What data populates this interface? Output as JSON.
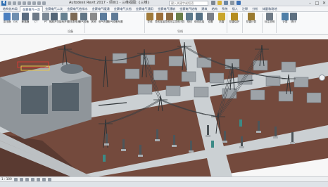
{
  "window": {
    "title": "Autodesk Revit 2017 -   项目1 - 三维视图: {三维}",
    "search_placeholder": "键入关键字或短语",
    "minimize": "–",
    "maximize": "□",
    "close": "✕"
  },
  "tabs": [
    {
      "label": "结构化布局",
      "active": false
    },
    {
      "label": "金赛电气一次",
      "active": true
    },
    {
      "label": "金赛电气二次",
      "active": false
    },
    {
      "label": "金赛电气给排水",
      "active": false
    },
    {
      "label": "金赛电气暖通",
      "active": false
    },
    {
      "label": "金赛电气文档",
      "active": false
    },
    {
      "label": "金赛电气通用",
      "active": false
    },
    {
      "label": "金赛电气建筑",
      "active": false
    },
    {
      "label": "金赛电气结构",
      "active": false
    },
    {
      "label": "建筑",
      "active": false
    },
    {
      "label": "结构",
      "active": false
    },
    {
      "label": "系统",
      "active": false
    },
    {
      "label": "插入",
      "active": false
    },
    {
      "label": "注释",
      "active": false
    },
    {
      "label": "分析",
      "active": false
    },
    {
      "label": "体量和场地",
      "active": false
    }
  ],
  "ribbon": {
    "tools": [
      {
        "label": "变压器",
        "icon": "transformer-icon",
        "color": "#4a7fc0"
      },
      {
        "label": "GIS",
        "icon": "gis-icon",
        "color": "#6f8fb0"
      },
      {
        "label": "断路器",
        "icon": "breaker-icon",
        "color": "#5a6c80"
      },
      {
        "label": "CT",
        "icon": "ct-icon",
        "color": "#6d7a88"
      },
      {
        "label": "PT",
        "icon": "pt-icon",
        "color": "#7a8794"
      },
      {
        "label": "隔离开关",
        "icon": "switch-icon",
        "color": "#556677"
      },
      {
        "label": "接地开关",
        "icon": "ground-switch-icon",
        "color": "#668090"
      },
      {
        "label": "低压配电柜",
        "icon": "cabinet-icon",
        "color": "#7d6a55"
      },
      {
        "label": "电气设备",
        "icon": "electrical-icon",
        "color": "#607585"
      },
      {
        "label": "其他",
        "icon": "misc-icon",
        "color": "#8a8a8a"
      },
      {
        "label": "电气布置",
        "icon": "layout-icon",
        "color": "#5c7c9c"
      },
      {
        "label": "电气设备布置",
        "icon": "equipment-layout-icon",
        "color": "#5e7a96"
      },
      {
        "label": "导线",
        "icon": "wire-icon",
        "color": "#a07a3a"
      },
      {
        "label": "导线连接",
        "icon": "wire-connect-icon",
        "color": "#9c6f3a"
      },
      {
        "label": "导线标注",
        "icon": "wire-tag-icon",
        "color": "#8c6a40"
      },
      {
        "label": "导线计算",
        "icon": "wire-calc-icon",
        "color": "#6a7f4a"
      },
      {
        "label": "母线",
        "icon": "busbar-icon",
        "color": "#5d7a8c"
      },
      {
        "label": "母线连接",
        "icon": "busbar-connect-icon",
        "color": "#557085"
      },
      {
        "label": "设置",
        "icon": "settings-icon",
        "color": "#7a7f88"
      },
      {
        "label": "防雷",
        "icon": "lightning-icon",
        "color": "#c9a52a"
      },
      {
        "label": "防雷保护",
        "icon": "lightning-protect-icon",
        "color": "#b58d1f"
      },
      {
        "label": "防雷计算",
        "icon": "lightning-calc-icon",
        "color": "#9a7a30"
      },
      {
        "label": "标注说明",
        "icon": "annotation-icon",
        "color": "#6e7a86"
      },
      {
        "label": "计算",
        "icon": "calculate-icon",
        "color": "#4f7fa8"
      },
      {
        "label": "统计",
        "icon": "statistics-icon",
        "color": "#5d6f80"
      }
    ],
    "panels": [
      {
        "label": "设备"
      },
      {
        "label": "导线"
      }
    ]
  },
  "statusbar": {
    "scale": "1 : 100"
  },
  "scene": {
    "colors": {
      "ground": "#744a3d",
      "ground_dark": "#5a3a31",
      "road": "#cbd0d3",
      "building": "#8f959a",
      "transformer": "#55616a",
      "wall": "#bcc0c3",
      "steel": "#2f3437",
      "accent_red": "#d23b35",
      "accent_yellow": "#e8c84a",
      "accent_teal": "#3c8a86"
    }
  }
}
